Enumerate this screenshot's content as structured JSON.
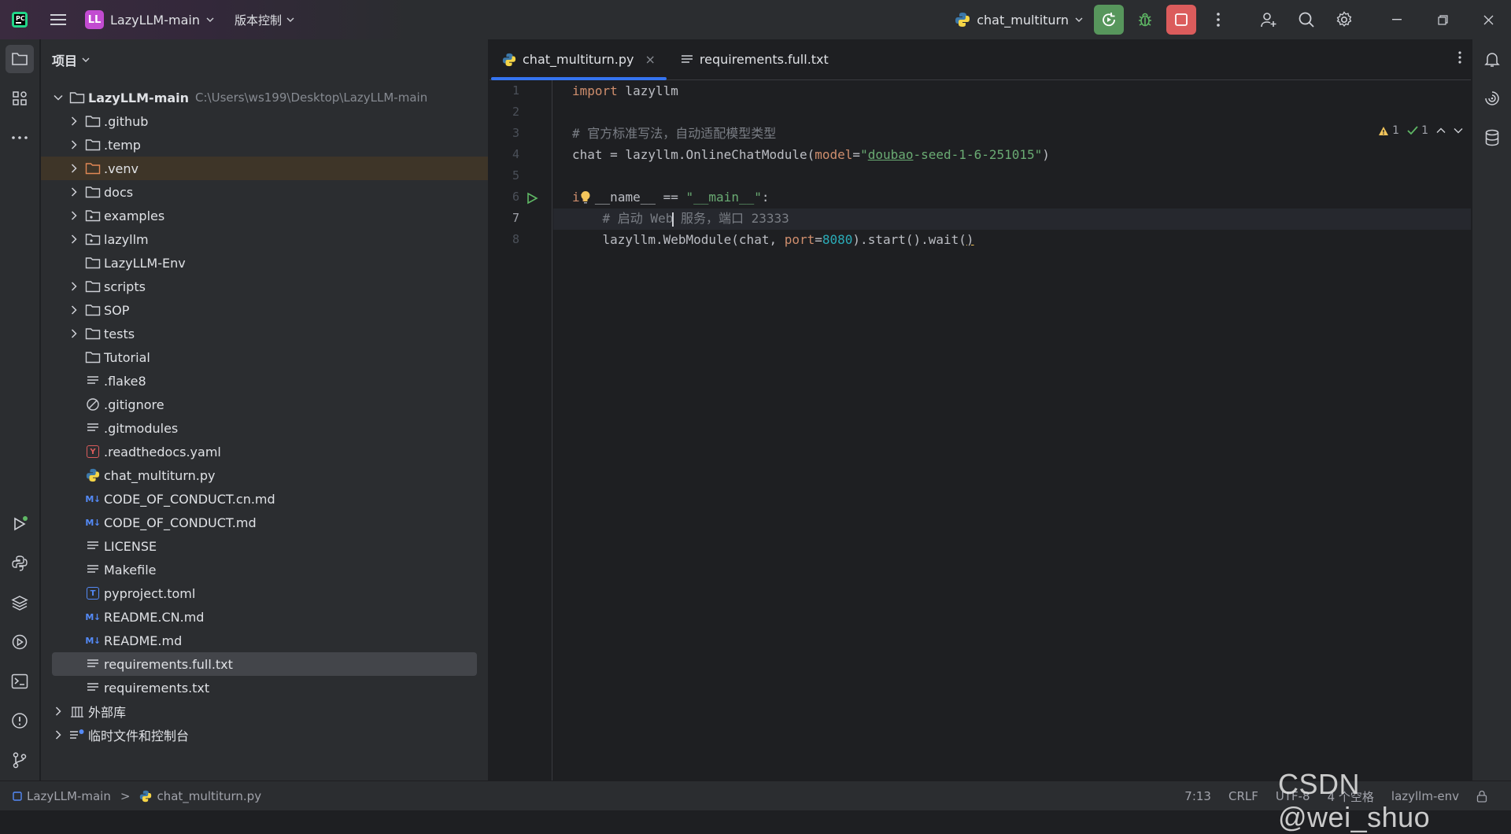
{
  "titlebar": {
    "project_initials": "LL",
    "project_name": "LazyLLM-main",
    "vcs_label": "版本控制",
    "run_config": "chat_multiturn"
  },
  "project_panel": {
    "title": "项目",
    "root_name": "LazyLLM-main",
    "root_path": "C:\\Users\\ws199\\Desktop\\LazyLLM-main",
    "items": [
      {
        "label": ".github"
      },
      {
        "label": ".temp"
      },
      {
        "label": ".venv"
      },
      {
        "label": "docs"
      },
      {
        "label": "examples"
      },
      {
        "label": "lazyllm"
      },
      {
        "label": "LazyLLM-Env"
      },
      {
        "label": "scripts"
      },
      {
        "label": "SOP"
      },
      {
        "label": "tests"
      },
      {
        "label": "Tutorial"
      },
      {
        "label": ".flake8"
      },
      {
        "label": ".gitignore"
      },
      {
        "label": ".gitmodules"
      },
      {
        "label": ".readthedocs.yaml"
      },
      {
        "label": "chat_multiturn.py"
      },
      {
        "label": "CODE_OF_CONDUCT.cn.md"
      },
      {
        "label": "CODE_OF_CONDUCT.md"
      },
      {
        "label": "LICENSE"
      },
      {
        "label": "Makefile"
      },
      {
        "label": "pyproject.toml"
      },
      {
        "label": "README.CN.md"
      },
      {
        "label": "README.md"
      },
      {
        "label": "requirements.full.txt"
      },
      {
        "label": "requirements.txt"
      }
    ],
    "external_libs": "外部库",
    "scratches": "临时文件和控制台",
    "md_badge": "M↓",
    "yaml_badge": "Y",
    "toml_badge": "T"
  },
  "editor": {
    "tabs": [
      {
        "label": "chat_multiturn.py",
        "close": "×"
      },
      {
        "label": "requirements.full.txt"
      }
    ],
    "inspections": {
      "warnings": "1",
      "ok": "1"
    },
    "line_numbers": [
      "1",
      "2",
      "3",
      "4",
      "5",
      "6",
      "7",
      "8"
    ],
    "code": {
      "l1_kw": "import",
      "l1_rest": " lazyllm",
      "l3_comment": "# 官方标准写法，自动适配模型类型",
      "l4_a": "chat = lazyllm.OnlineChatModule(",
      "l4_param": "model",
      "l4_eq": "=",
      "l4_q1": "\"",
      "l4_str_und": "doubao",
      "l4_str_rest": "-seed-1-6-251015\"",
      "l4_close": ")",
      "l6_kw1": "i",
      "l6_kw2": "f",
      "l6_a": " __name__ == ",
      "l6_str": "\"__main__\"",
      "l6_colon": ":",
      "l7_comment_a": "    # 启动 Web",
      "l7_comment_b": " 服务，端口 23333",
      "l8_a": "    lazyllm.WebModule(chat, ",
      "l8_param": "port",
      "l8_eq": "=",
      "l8_num": "8080",
      "l8_b": ").start().wait(",
      "l8_close": ")"
    }
  },
  "statusbar": {
    "crumb_project": "LazyLLM-main",
    "crumb_sep": ">",
    "crumb_file": "chat_multiturn.py",
    "position": "7:13",
    "line_sep": "CRLF",
    "encoding": "UTF-8",
    "indent": "4 个空格",
    "interpreter": "lazyllm-env"
  },
  "watermark": "CSDN @wei_shuo",
  "colors": {
    "accent": "#3574f0",
    "run": "#57965c",
    "stop": "#db5c5c",
    "venv_bg": "#3e3528"
  }
}
